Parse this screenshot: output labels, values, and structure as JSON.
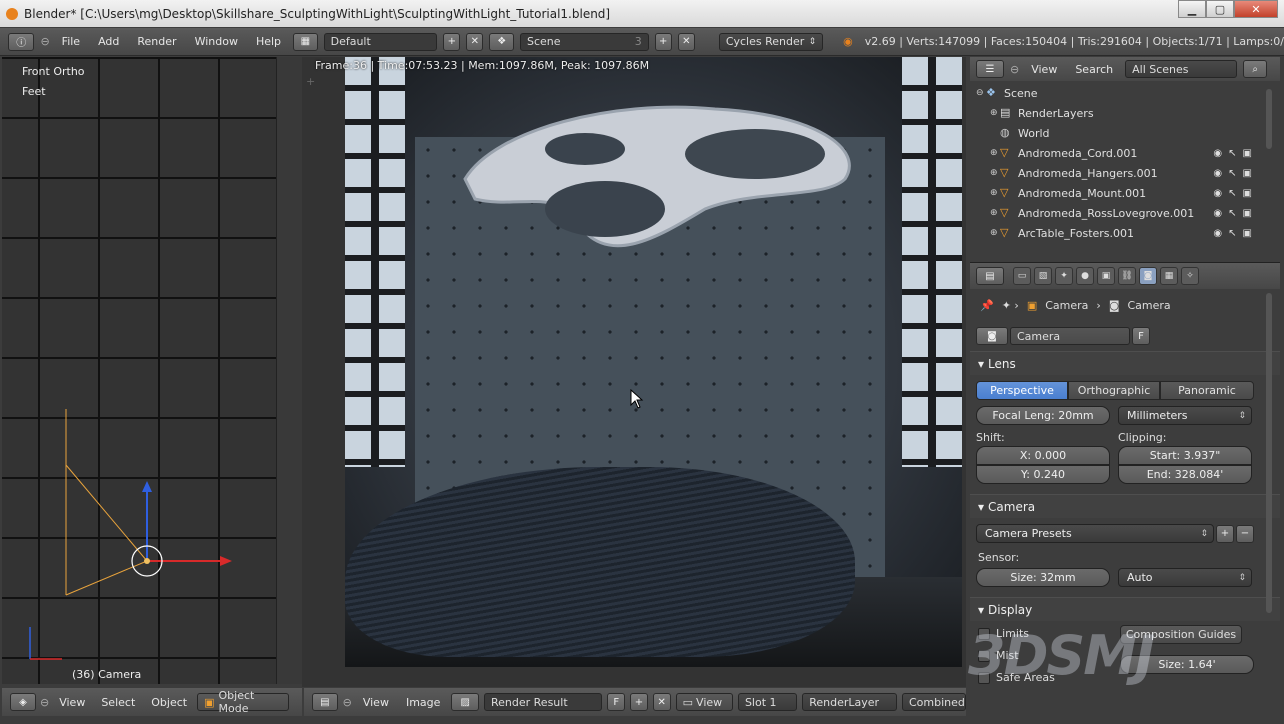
{
  "title": "Blender* [C:\\Users\\mg\\Desktop\\Skillshare_SculptingWithLight\\SculptingWithLight_Tutorial1.blend]",
  "window_controls": {
    "min": "▁",
    "max": "▢",
    "close": "✕"
  },
  "infobar": {
    "menus": [
      "File",
      "Add",
      "Render",
      "Window",
      "Help"
    ],
    "screen": "Default",
    "scene": "Scene",
    "scene_users": "3",
    "engine": "Cycles Render",
    "stats": "v2.69 | Verts:147099 | Faces:150404 | Tris:291604 | Objects:1/71 | Lamps:0/"
  },
  "viewport": {
    "view_name": "Front Ortho",
    "units": "Feet",
    "object_label": "(36) Camera",
    "header": {
      "view": "View",
      "select": "Select",
      "object": "Object",
      "mode": "Object Mode"
    }
  },
  "render": {
    "info": "Frame:36 | Time:07:53.23 | Mem:1097.86M, Peak: 1097.86M"
  },
  "image_editor_header": {
    "view": "View",
    "image": "Image",
    "result": "Render Result",
    "f": "F",
    "view_menu": "View",
    "slot": "Slot 1",
    "layer": "RenderLayer",
    "pass": "Combined"
  },
  "outliner": {
    "view": "View",
    "search": "Search",
    "filter": "All Scenes",
    "items": [
      {
        "label": "Scene",
        "indent": 0,
        "tri": "⊖"
      },
      {
        "label": "RenderLayers",
        "indent": 1,
        "tri": "⊕"
      },
      {
        "label": "World",
        "indent": 1,
        "tri": ""
      },
      {
        "label": "Andromeda_Cord.001",
        "indent": 1,
        "tri": "⊕"
      },
      {
        "label": "Andromeda_Hangers.001",
        "indent": 1,
        "tri": "⊕"
      },
      {
        "label": "Andromeda_Mount.001",
        "indent": 1,
        "tri": "⊕"
      },
      {
        "label": "Andromeda_RossLovegrove.001",
        "indent": 1,
        "tri": "⊕"
      },
      {
        "label": "ArcTable_Fosters.001",
        "indent": 1,
        "tri": "⊕"
      }
    ]
  },
  "properties": {
    "breadcrumb": [
      "Camera",
      "Camera"
    ],
    "datablock": "Camera",
    "datablock_f": "F",
    "lens": {
      "title": "Lens",
      "types": [
        "Perspective",
        "Orthographic",
        "Panoramic"
      ],
      "active_type": "Perspective",
      "focal": "Focal Leng: 20mm",
      "unit": "Millimeters",
      "shift_label": "Shift:",
      "shift_x": "X: 0.000",
      "shift_y": "Y: 0.240",
      "clip_label": "Clipping:",
      "clip_start": "Start: 3.937\"",
      "clip_end": "End: 328.084'"
    },
    "camera": {
      "title": "Camera",
      "presets": "Camera Presets",
      "sensor_label": "Sensor:",
      "size": "Size: 32mm",
      "fit": "Auto"
    },
    "display": {
      "title": "Display",
      "limits": "Limits",
      "mist": "Mist",
      "safe": "Safe Areas",
      "guides": "Composition Guides",
      "size": "Size: 1.64'"
    }
  },
  "watermark": "3DSMJ"
}
